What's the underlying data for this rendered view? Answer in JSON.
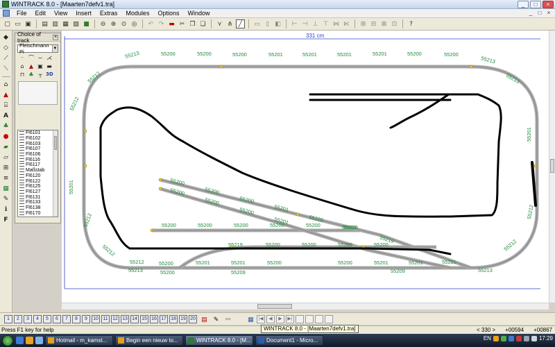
{
  "window": {
    "title": "WINTRACK 8.0 - [Maarten7defv1.tra]",
    "controls": [
      "_",
      "□",
      "×"
    ]
  },
  "menubar": {
    "items": [
      "File",
      "Edit",
      "View",
      "Insert",
      "Extras",
      "Modules",
      "Options",
      "Window"
    ],
    "mdi_controls": [
      "_",
      "□",
      "×"
    ]
  },
  "toolbar": {
    "icons": [
      "new-icon",
      "open-icon",
      "save-icon",
      "print-preview-icon",
      "print-icon",
      "copy-icon",
      "paste-icon",
      "layer-icon",
      "zoom-out-icon",
      "zoom-in-icon",
      "zoom-fit-icon",
      "zoom-window-icon",
      "undo-icon",
      "redo-icon",
      "delete-icon",
      "cut-icon",
      "copy2-icon",
      "paste2-icon",
      "select-icon",
      "snap-icon",
      "line-icon",
      "shape-icon",
      "rotate-icon",
      "flip-icon",
      "align-icon",
      "join-icon",
      "split-icon",
      "measure-icon",
      "track-icon",
      "help-icon"
    ]
  },
  "panel": {
    "title": "Choice of track",
    "manufacturer": "Fleischmann Pi",
    "three_d_label": "3D",
    "tracks": [
      "Fl6101",
      "Fl6102",
      "Fl6103",
      "Fl6107",
      "Fl6106",
      "Fl6116",
      "Fl6117",
      "Maßstab",
      "Fl6120",
      "Fl6122",
      "Fl6125",
      "Fl6127",
      "Fl6131",
      "Fl6133",
      "Fl6138",
      "Fl6170"
    ]
  },
  "canvas": {
    "ruler_label": "331 cm",
    "track_labels": {
      "top": [
        "55200",
        "55200",
        "55200",
        "55201",
        "55201",
        "55201",
        "55201",
        "55200",
        "55200"
      ],
      "top_corner": "55213",
      "bottom": [
        "55200",
        "55201",
        "55201",
        "55200",
        "55200",
        "55201",
        "55201"
      ],
      "bottom_under": [
        "55200",
        "55209",
        "55209"
      ],
      "siding": [
        "55200",
        "55200",
        "55200",
        "55200",
        "55200",
        "55200",
        "55220"
      ],
      "middle_a": [
        "55200",
        "55200",
        "55200",
        "55201",
        "55220",
        "55219"
      ],
      "middle_b": [
        "55200",
        "55200",
        "55200",
        "55201"
      ],
      "bottom_mid": [
        "55219",
        "55200",
        "55200",
        "55200",
        "55200",
        "55221"
      ],
      "left_side": [
        "55212",
        "55201",
        "55212",
        "55212"
      ],
      "right_side": [
        "55213",
        "55201",
        "55212",
        "55212",
        "55213"
      ],
      "corners": [
        "55212",
        "55213",
        "55212",
        "55213"
      ]
    }
  },
  "modules": {
    "tabs": [
      "1",
      "2",
      "3",
      "4",
      "5",
      "6",
      "7",
      "8",
      "9",
      "10",
      "11",
      "12",
      "13",
      "14",
      "15",
      "16",
      "17",
      "18",
      "19",
      "20"
    ]
  },
  "statusbar": {
    "help_text": "Press F1 key for help",
    "tooltip": "WINTRACK 8.0 - [Maarten7defv1.tra]",
    "zoom": "< 330 >",
    "x_coord": "+00594",
    "y_coord": "+00867"
  },
  "taskbar": {
    "buttons": [
      {
        "label": "Hotmail - m_kamst...",
        "icon_color": "#e4a020"
      },
      {
        "label": "Begin een nieuw to...",
        "icon_color": "#e4a020"
      },
      {
        "label": "WINTRACK 8.0 - [M...",
        "icon_color": "#2e7d32"
      },
      {
        "label": "Document1 - Micro...",
        "icon_color": "#2a5db0"
      }
    ],
    "language": "EN",
    "time": "17:29"
  },
  "colors": {
    "track_gray": "#a9a9a9",
    "label_green": "#1e8a3a",
    "ruler_blue": "#2b3fc4",
    "sketch_black": "#000000",
    "switch_yellow": "#f2d43a"
  }
}
